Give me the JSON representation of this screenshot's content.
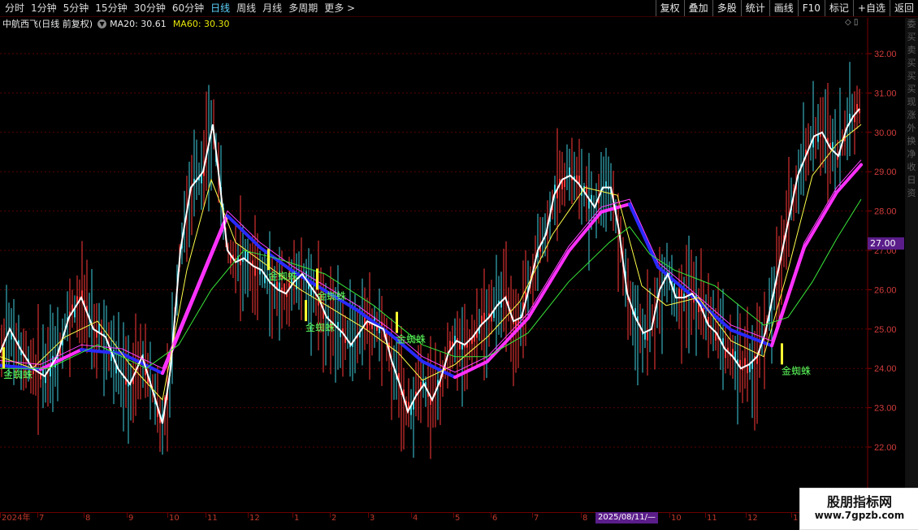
{
  "periods": [
    {
      "label": "分时",
      "active": false
    },
    {
      "label": "1分钟",
      "active": false
    },
    {
      "label": "5分钟",
      "active": false
    },
    {
      "label": "15分钟",
      "active": false
    },
    {
      "label": "30分钟",
      "active": false
    },
    {
      "label": "60分钟",
      "active": false
    },
    {
      "label": "日线",
      "active": true
    },
    {
      "label": "周线",
      "active": false
    },
    {
      "label": "月线",
      "active": false
    },
    {
      "label": "多周期",
      "active": false
    },
    {
      "label": "更多 >",
      "active": false
    }
  ],
  "tools": [
    "复权",
    "叠加",
    "多股",
    "统计",
    "画线",
    "F10",
    "标记",
    "+自选",
    "返回"
  ],
  "info": {
    "title": "中航西飞(日线 前复权)",
    "ma20": "MA20: 30.61",
    "ma60": "MA60: 30.30"
  },
  "price_label": "27.00",
  "cursor_date": "2025/08/11/—",
  "signal_label": "金蜘蛛",
  "watermark": {
    "line1": "股朋指标网",
    "line2": "www.7gpzb.com"
  },
  "right_strip_chars": [
    "委",
    "买",
    "卖",
    "买",
    "买",
    "买",
    "现",
    "涨",
    "外",
    "换",
    "净",
    "收",
    "日",
    "资"
  ],
  "colors": {
    "up": "#ff3a3a",
    "down": "#3fd0e0",
    "ma5": "#ffffff",
    "ma10": "#ffff4a",
    "ma20": "#ff40ff",
    "ma60": "#39e639",
    "trend_blue": "#2a2aff",
    "trend_magenta": "#ff30ff",
    "signal": "#5cff5c"
  },
  "chart_data": {
    "type": "line",
    "title": "中航西飞(日线 前复权)",
    "y_axis": {
      "ticks": [
        "32.00",
        "31.00",
        "30.00",
        "29.00",
        "28.00",
        "27.00",
        "26.00",
        "25.00",
        "24.00",
        "23.00",
        "22.00"
      ],
      "range": [
        21.0,
        33.3
      ]
    },
    "x_axis_labels": [
      "2024年",
      "7",
      "8",
      "9",
      "10",
      "11",
      "12",
      "1",
      "2",
      "3",
      "4",
      "5",
      "6",
      "7",
      "8",
      "9",
      "10",
      "11",
      "12",
      "1"
    ],
    "signals": [
      {
        "label": "金蜘蛛",
        "x": "2024-06",
        "y": 24.0
      },
      {
        "label": "金蜘蛛",
        "x": "2024-12",
        "y": 26.5
      },
      {
        "label": "金蜘蛛",
        "x": "2025-01",
        "y": 25.2
      },
      {
        "label": "金蜘蛛",
        "x": "2025-01",
        "y": 26.0
      },
      {
        "label": "金蜘蛛",
        "x": "2025-03",
        "y": 24.9
      },
      {
        "label": "金蜘蛛",
        "x": "2025-12",
        "y": 24.1
      }
    ],
    "series": [
      {
        "color": "#ffffff",
        "x": [
          0,
          12,
          25,
          40,
          55,
          70,
          85,
          100,
          115,
          130,
          145,
          160,
          175,
          190,
          200,
          210,
          222,
          235,
          250,
          262,
          270,
          280,
          290,
          300,
          312,
          322,
          332,
          342,
          352,
          362,
          372,
          382,
          392,
          402,
          412,
          422,
          432,
          442,
          452,
          462,
          472,
          482,
          492,
          502,
          512,
          522,
          532,
          542,
          552,
          562,
          572,
          582,
          592,
          602,
          612,
          622,
          632,
          642,
          652,
          662,
          672,
          682,
          692,
          702,
          712,
          722,
          732,
          742,
          752,
          762,
          772,
          782,
          792,
          802,
          812,
          822,
          832,
          842,
          852,
          862,
          872,
          882,
          892,
          902,
          912,
          922,
          932,
          942,
          952,
          962,
          972,
          982,
          992,
          1002,
          1012,
          1022,
          1032,
          1042,
          1050,
          1058
        ],
        "y": [
          24.4,
          25.0,
          24.5,
          24.0,
          23.8,
          24.3,
          25.3,
          25.8,
          25.0,
          24.8,
          24.0,
          23.6,
          24.3,
          23.3,
          22.6,
          24.0,
          27.0,
          28.6,
          29.0,
          30.2,
          28.8,
          27.0,
          26.7,
          26.8,
          26.6,
          26.5,
          26.2,
          26.0,
          25.9,
          26.2,
          26.4,
          26.1,
          25.8,
          25.3,
          25.1,
          24.9,
          24.6,
          24.9,
          25.2,
          25.1,
          25.0,
          24.2,
          23.6,
          22.9,
          23.3,
          23.6,
          23.2,
          23.7,
          24.4,
          24.7,
          24.6,
          24.8,
          25.1,
          25.3,
          25.6,
          25.8,
          25.2,
          25.3,
          26.1,
          27.0,
          27.4,
          28.4,
          28.8,
          28.9,
          28.7,
          28.4,
          28.1,
          28.6,
          28.6,
          27.5,
          25.9,
          25.3,
          24.9,
          25.0,
          26.0,
          26.4,
          25.8,
          25.8,
          25.9,
          25.6,
          25.1,
          24.9,
          24.5,
          24.3,
          24.0,
          24.1,
          24.3,
          24.9,
          25.9,
          26.9,
          27.9,
          28.9,
          29.4,
          29.9,
          30.0,
          29.6,
          29.4,
          30.1,
          30.4,
          30.6
        ]
      },
      {
        "color": "#ffff4a",
        "x": [
          0,
          40,
          80,
          120,
          160,
          200,
          230,
          260,
          290,
          330,
          370,
          410,
          450,
          490,
          520,
          560,
          600,
          640,
          680,
          720,
          760,
          790,
          820,
          860,
          900,
          940,
          970,
          1000,
          1030,
          1060
        ],
        "y": [
          24.3,
          24.0,
          24.8,
          25.2,
          24.1,
          23.2,
          26.5,
          28.8,
          27.2,
          26.6,
          26.0,
          25.5,
          25.0,
          24.4,
          23.7,
          24.1,
          24.8,
          25.7,
          27.4,
          28.6,
          28.4,
          26.1,
          25.6,
          25.8,
          24.7,
          24.3,
          26.5,
          28.9,
          29.7,
          30.2
        ]
      },
      {
        "color": "#ff40ff",
        "x": [
          0,
          50,
          100,
          150,
          200,
          240,
          280,
          320,
          360,
          400,
          440,
          480,
          520,
          560,
          600,
          650,
          700,
          740,
          775,
          810,
          850,
          900,
          950,
          990,
          1030,
          1060
        ],
        "y": [
          24.2,
          24.1,
          24.6,
          24.5,
          24.0,
          26.0,
          28.0,
          27.2,
          26.6,
          26.1,
          25.6,
          25.0,
          24.3,
          23.9,
          24.3,
          25.4,
          27.1,
          28.1,
          28.3,
          26.7,
          26.0,
          25.1,
          24.7,
          27.2,
          28.6,
          29.3
        ]
      },
      {
        "color": "#39e639",
        "x": [
          0,
          60,
          120,
          180,
          220,
          260,
          300,
          340,
          400,
          460,
          520,
          560,
          600,
          650,
          700,
          750,
          775,
          800,
          830,
          880,
          940,
          970,
          1000,
          1030,
          1060
        ],
        "y": [
          24.0,
          24.0,
          24.6,
          24.0,
          24.6,
          26.0,
          27.0,
          26.8,
          26.4,
          25.6,
          24.6,
          24.3,
          24.3,
          24.9,
          26.2,
          27.2,
          27.6,
          26.9,
          26.5,
          26.1,
          25.1,
          25.3,
          26.2,
          27.3,
          28.3
        ]
      }
    ]
  }
}
